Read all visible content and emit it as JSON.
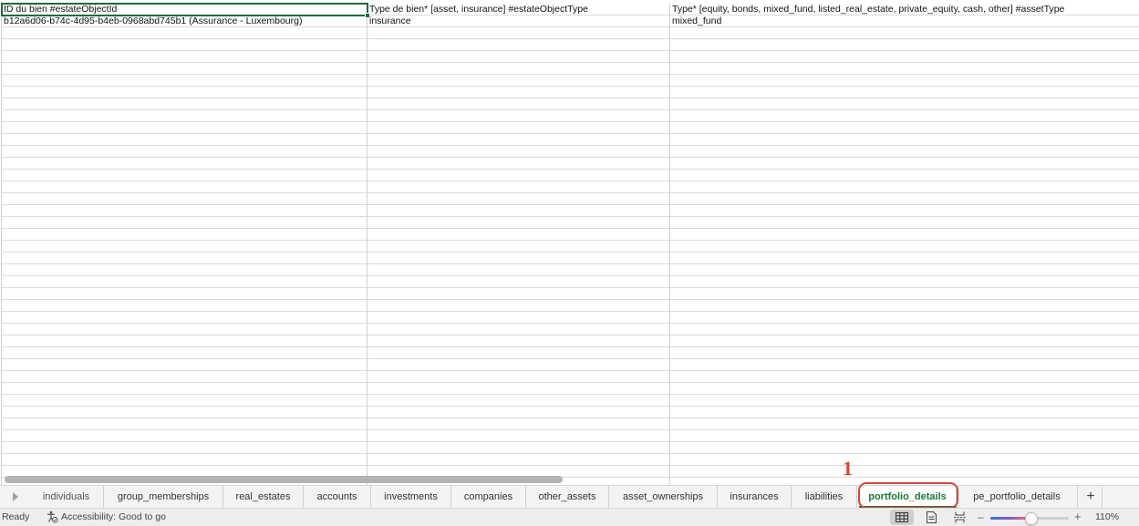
{
  "sheet": {
    "columns": [
      {
        "header": "ID du bien #estateObjectId",
        "row1": "b12a6d06-b74c-4d95-b4eb-0968abd745b1 (Assurance - Luxembourg)"
      },
      {
        "header": "Type de bien* [asset, insurance] #estateObjectType",
        "row1": "insurance"
      },
      {
        "header": "Type* [equity, bonds, mixed_fund, listed_real_estate, private_equity, cash, other] #assetType",
        "row1": "mixed_fund"
      }
    ]
  },
  "tabs": {
    "items": [
      {
        "label": "individuals"
      },
      {
        "label": "group_memberships"
      },
      {
        "label": "real_estates"
      },
      {
        "label": "accounts"
      },
      {
        "label": "investments"
      },
      {
        "label": "companies"
      },
      {
        "label": "other_assets"
      },
      {
        "label": "asset_ownerships"
      },
      {
        "label": "insurances"
      },
      {
        "label": "liabilities"
      },
      {
        "label": "portfolio_details"
      },
      {
        "label": "pe_portfolio_details"
      }
    ],
    "active": "portfolio_details",
    "add_label": "+",
    "nav_icon": "chevron-right-icon"
  },
  "annotation": {
    "number": "1",
    "color": "#d64537"
  },
  "status": {
    "ready": "Ready",
    "accessibility": "Accessibility: Good to go",
    "zoom_minus": "–",
    "zoom_plus": "+",
    "zoom_level": "110%",
    "view_modes": [
      "normal-view-icon",
      "page-layout-icon",
      "page-break-preview-icon"
    ],
    "active_view": "normal-view-icon"
  },
  "colors": {
    "accent_green": "#1a7a35",
    "active_cell_border": "#1d6b3c"
  }
}
